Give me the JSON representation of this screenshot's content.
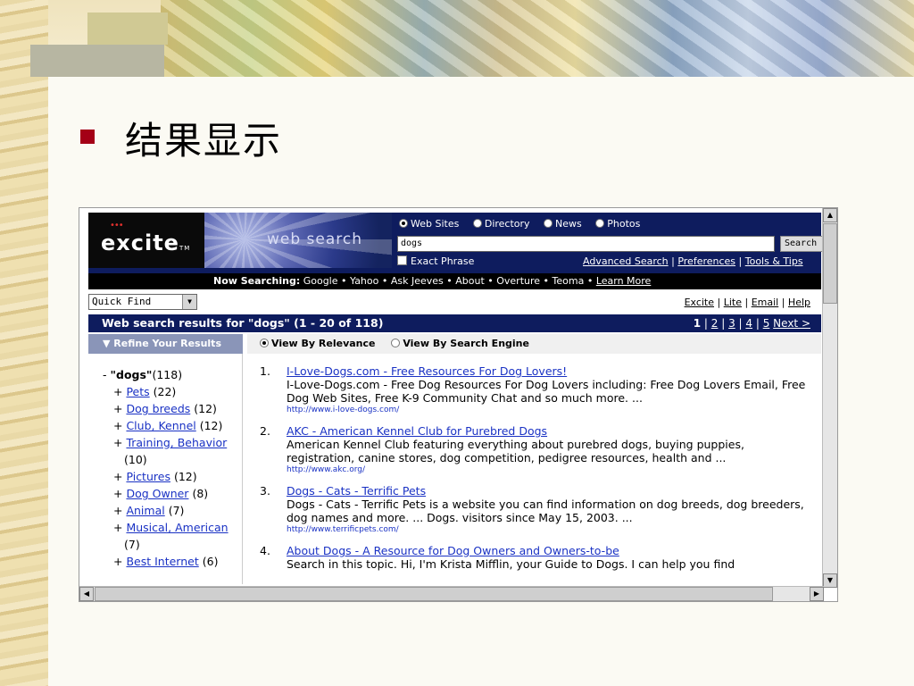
{
  "slide": {
    "title": "结果显示"
  },
  "header": {
    "logo": "excite",
    "tagline": "web search",
    "radios": [
      "Web Sites",
      "Directory",
      "News",
      "Photos"
    ],
    "selected_radio": "Web Sites",
    "search_value": "dogs",
    "search_button": "Search",
    "exact_phrase": "Exact Phrase",
    "adv_links": [
      "Advanced Search",
      "Preferences",
      "Tools & Tips"
    ]
  },
  "now_searching": {
    "label": "Now Searching:",
    "engines": "Google • Yahoo • Ask Jeeves • About • Overture • Teoma •",
    "learn_more": "Learn More"
  },
  "quick_find": {
    "value": "Quick Find"
  },
  "top_links": [
    "Excite",
    "Lite",
    "Email",
    "Help"
  ],
  "results_bar": {
    "title": "Web search results for \"dogs\" (1 - 20 of 118)",
    "pages": [
      "1",
      "2",
      "3",
      "4",
      "5"
    ],
    "next": "Next >"
  },
  "refine": {
    "label": "Refine Your Results"
  },
  "view": {
    "relevance": "View By Relevance",
    "engine": "View By Search Engine"
  },
  "left": {
    "root": {
      "prefix": "-",
      "label": "\"dogs\"",
      "count": "(118)"
    },
    "items": [
      {
        "label": "Pets",
        "count": "(22)"
      },
      {
        "label": "Dog breeds",
        "count": "(12)"
      },
      {
        "label": "Club, Kennel",
        "count": "(12)"
      },
      {
        "label": "Training, Behavior",
        "count": "(10)"
      },
      {
        "label": "Pictures",
        "count": "(12)"
      },
      {
        "label": "Dog Owner",
        "count": "(8)"
      },
      {
        "label": "Animal",
        "count": "(7)"
      },
      {
        "label": "Musical, American",
        "count": "(7)"
      },
      {
        "label": "Best Internet",
        "count": "(6)"
      }
    ]
  },
  "results": [
    {
      "num": "1.",
      "title": "I-Love-Dogs.com - Free Resources For Dog Lovers!",
      "desc": "I-Love-Dogs.com - Free Dog Resources For Dog Lovers including: Free Dog Lovers Email, Free Dog Web Sites, Free K-9 Community Chat and so much more. ...",
      "url": "http://www.i-love-dogs.com/"
    },
    {
      "num": "2.",
      "title": "AKC - American Kennel Club for Purebred Dogs",
      "desc": "American Kennel Club featuring everything about purebred dogs, buying puppies, registration, canine stores, dog competition, pedigree resources, health and ...",
      "url": "http://www.akc.org/"
    },
    {
      "num": "3.",
      "title": "Dogs - Cats - Terrific Pets",
      "desc": "Dogs - Cats - Terrific Pets is a website you can find information on dog breeds, dog breeders, dog names and more. ... Dogs. visitors since May 15, 2003. ...",
      "url": "http://www.terrificpets.com/"
    },
    {
      "num": "4.",
      "title": "About Dogs - A Resource for Dog Owners and Owners-to-be",
      "desc": "Search in this topic. Hi, I'm Krista Mifflin, your Guide to Dogs. I can help you find",
      "url": ""
    }
  ],
  "colors": {
    "nav": "#0e1c5e",
    "link": "#1a32c4",
    "bullet": "#a40016"
  }
}
